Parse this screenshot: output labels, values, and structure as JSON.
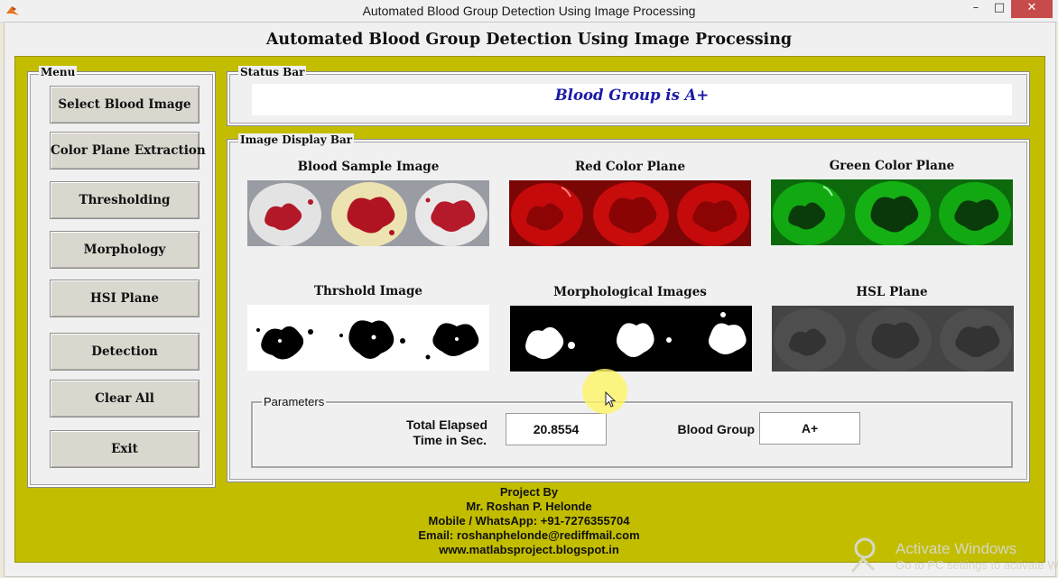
{
  "window": {
    "title": "Automated Blood Group Detection Using Image Processing",
    "controls": {
      "minimize": "–",
      "maximize": "□",
      "close": "✕"
    },
    "app_icon": "matlab-icon"
  },
  "heading": "Automated Blood Group Detection Using Image Processing",
  "menu": {
    "label": "Menu",
    "buttons": [
      "Select Blood Image",
      "Color Plane Extraction",
      "Thresholding",
      "Morphology",
      "HSI Plane",
      "Detection",
      "Clear All",
      "Exit"
    ]
  },
  "status_bar": {
    "label": "Status Bar",
    "text": "Blood Group is A+"
  },
  "image_display": {
    "label": "Image Display Bar",
    "images": [
      {
        "title": "Blood Sample Image"
      },
      {
        "title": "Red Color Plane"
      },
      {
        "title": "Green Color Plane"
      },
      {
        "title": "Thrshold Image"
      },
      {
        "title": "Morphological Images"
      },
      {
        "title": "HSL Plane"
      }
    ]
  },
  "parameters": {
    "label": "Parameters",
    "elapsed_label_line1": "Total Elapsed",
    "elapsed_label_line2": "Time in Sec.",
    "elapsed_value": "20.8554",
    "blood_group_label": "Blood Group",
    "blood_group_value": "A+"
  },
  "credits": [
    "Project By",
    "Mr. Roshan P. Helonde",
    "Mobile / WhatsApp: +91-7276355704",
    "Email: roshanphelonde@rediffmail.com",
    "www.matlabsproject.blogspot.in"
  ],
  "watermark": {
    "line1": "Activate Windows",
    "line2": "Go to PC settings to activate Windows."
  },
  "colors": {
    "panel_bg": "#c3bd00",
    "status_text": "#1a1aa8",
    "close_button": "#c74b4b"
  }
}
